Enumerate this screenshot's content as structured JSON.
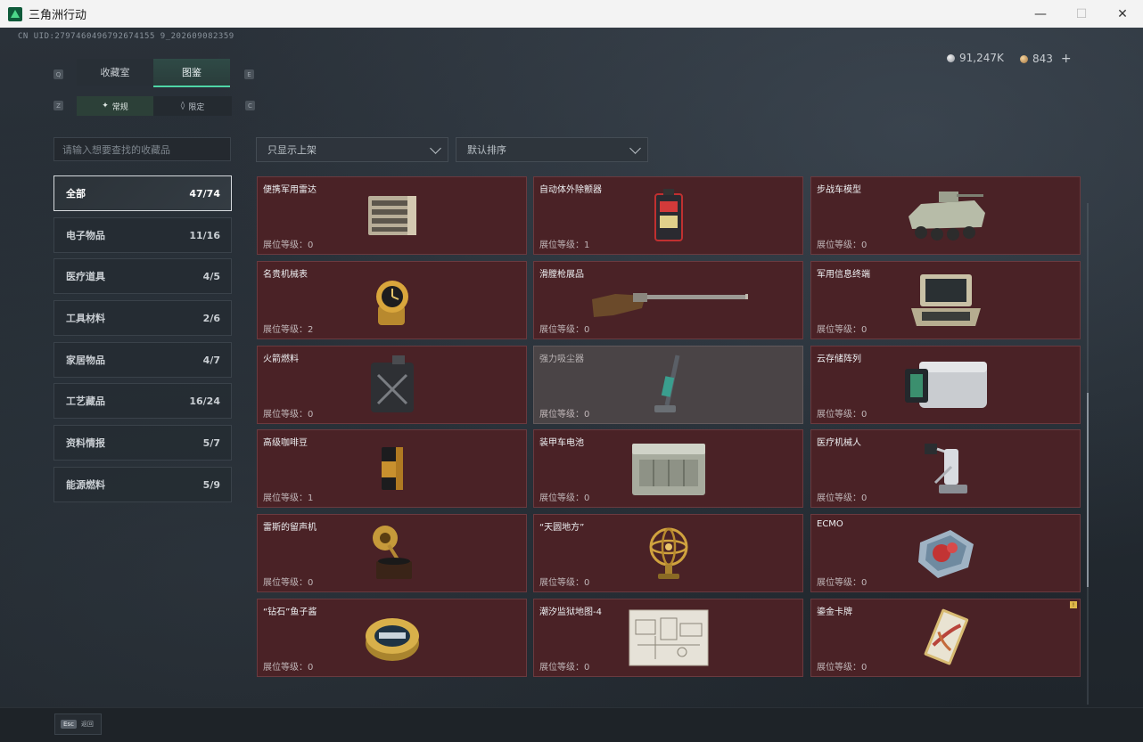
{
  "window": {
    "title": "三角洲行动"
  },
  "header": {
    "uid": "CN UID:2797460496792674155 9_202609082359",
    "silver_amount": "91,247K",
    "gold_amount": "843",
    "gold_add": "+"
  },
  "tabs": [
    {
      "label": "收藏室",
      "active": false
    },
    {
      "label": "图鉴",
      "active": true
    }
  ],
  "subtabs": [
    {
      "label": "常规",
      "active": true
    },
    {
      "label": "限定",
      "active": false
    }
  ],
  "keyhints": {
    "q": "Q",
    "e": "E",
    "z": "Z",
    "c": "C"
  },
  "search": {
    "placeholder": "请输入想要查找的收藏品"
  },
  "filters": {
    "listed_only": "只显示上架",
    "sort": "默认排序"
  },
  "categories": [
    {
      "label": "全部",
      "count": "47/74",
      "active": true
    },
    {
      "label": "电子物品",
      "count": "11/16"
    },
    {
      "label": "医疗道具",
      "count": "4/5"
    },
    {
      "label": "工具材料",
      "count": "2/6"
    },
    {
      "label": "家居物品",
      "count": "4/7"
    },
    {
      "label": "工艺藏品",
      "count": "16/24"
    },
    {
      "label": "资料情报",
      "count": "5/7"
    },
    {
      "label": "能源燃料",
      "count": "5/9"
    }
  ],
  "items": [
    {
      "name": "便携军用雷达",
      "level": "展位等级：0",
      "icon": "radar-icon"
    },
    {
      "name": "自动体外除颤器",
      "level": "展位等级：1",
      "icon": "defibrillator-icon"
    },
    {
      "name": "步战车模型",
      "level": "展位等级：0",
      "icon": "ifv-model-icon"
    },
    {
      "name": "名贵机械表",
      "level": "展位等级：2",
      "icon": "watch-icon"
    },
    {
      "name": "滑膛枪展品",
      "level": "展位等级：0",
      "icon": "musket-icon"
    },
    {
      "name": "军用信息终端",
      "level": "展位等级：0",
      "icon": "terminal-icon"
    },
    {
      "name": "火箭燃料",
      "level": "展位等级：0",
      "icon": "fuel-can-icon"
    },
    {
      "name": "强力吸尘器",
      "level": "展位等级：0",
      "icon": "vacuum-icon"
    },
    {
      "name": "云存储阵列",
      "level": "展位等级：0",
      "icon": "storage-array-icon"
    },
    {
      "name": "高级咖啡豆",
      "level": "展位等级：1",
      "icon": "coffee-bag-icon"
    },
    {
      "name": "装甲车电池",
      "level": "展位等级：0",
      "icon": "battery-icon"
    },
    {
      "name": "医疗机械人",
      "level": "展位等级：0",
      "icon": "medical-robot-icon"
    },
    {
      "name": "雷斯的留声机",
      "level": "展位等级：0",
      "icon": "gramophone-icon"
    },
    {
      "name": "“天圆地方”",
      "level": "展位等级：0",
      "icon": "armillary-icon"
    },
    {
      "name": "ECMO",
      "level": "展位等级：0",
      "icon": "ecmo-icon"
    },
    {
      "name": "“钻石”鱼子酱",
      "level": "展位等级：0",
      "icon": "caviar-tin-icon"
    },
    {
      "name": "潮汐监狱地图-4",
      "level": "展位等级：0",
      "icon": "map-icon"
    },
    {
      "name": "鎏金卡牌",
      "level": "展位等级：0",
      "icon": "gold-card-icon",
      "badge": "!"
    }
  ],
  "bottom": {
    "esc_key": "Esc",
    "esc_label": "返回"
  }
}
